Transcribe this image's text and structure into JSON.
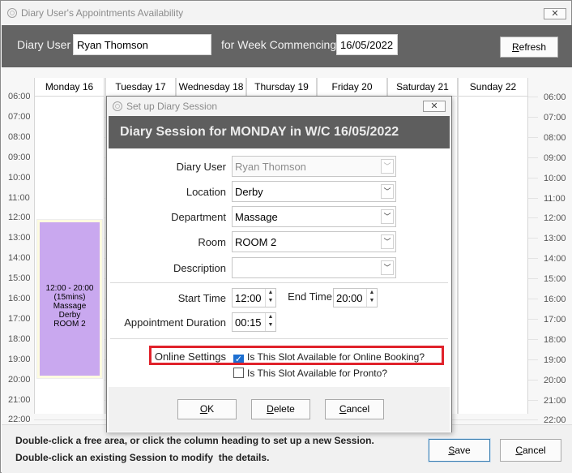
{
  "window": {
    "title": "Diary User's Appointments Availability",
    "close_icon": "close-icon"
  },
  "header": {
    "diary_user_label": "Diary User",
    "diary_user_value": "Ryan Thomson",
    "week_label": "for Week Commencing",
    "week_value": "16/05/2022",
    "refresh_label": "Refresh",
    "refresh_access_key": "R",
    "refresh_rest": "efresh"
  },
  "calendar": {
    "times": [
      "06:00",
      "07:00",
      "08:00",
      "09:00",
      "10:00",
      "11:00",
      "12:00",
      "13:00",
      "14:00",
      "15:00",
      "16:00",
      "17:00",
      "18:00",
      "19:00",
      "20:00",
      "21:00",
      "22:00"
    ],
    "days": [
      "Monday 16",
      "Tuesday 17",
      "Wednesday 18",
      "Thursday 19",
      "Friday 20",
      "Saturday 21",
      "Sunday 22"
    ],
    "session": {
      "time": "12:00 - 20:00",
      "duration": "(15mins)",
      "department": "Massage",
      "location": "Derby",
      "room": "ROOM 2",
      "color": "#c9a8ef"
    }
  },
  "footer": {
    "hint1": "Double-click a free area, or click the column heading to set up a new Session.",
    "hint2": "Double-click an existing Session to modify  the details.",
    "save_label": "Save",
    "save_access_key": "S",
    "save_rest": "ave",
    "cancel_label": "Cancel",
    "cancel_access_key": "C",
    "cancel_rest": "ancel"
  },
  "dialog": {
    "title": "Set up Diary Session",
    "heading": "Diary Session for MONDAY in W/C 16/05/2022",
    "fields": {
      "diary_user_label": "Diary User",
      "diary_user_value": "Ryan Thomson",
      "location_label": "Location",
      "location_value": "Derby",
      "department_label": "Department",
      "department_value": "Massage",
      "room_label": "Room",
      "room_value": "ROOM 2",
      "description_label": "Description",
      "description_value": ""
    },
    "times": {
      "start_label": "Start Time",
      "start_value": "12:00",
      "end_label": "End Time",
      "end_value": "20:00",
      "duration_label": "Appointment Duration",
      "duration_value": "00:15"
    },
    "online": {
      "label": "Online Settings",
      "online_booking_label": "Is This Slot Available for Online Booking?",
      "online_booking_checked": true,
      "pronto_label": "Is This Slot Available for Pronto?",
      "pronto_checked": false,
      "highlight_color": "#e0222b"
    },
    "buttons": {
      "ok_label": "OK",
      "ok_access_key": "O",
      "ok_rest": "K",
      "delete_label": "Delete",
      "delete_access_key": "D",
      "delete_rest": "elete",
      "cancel_label": "Cancel",
      "cancel_access_key": "C",
      "cancel_rest": "ancel"
    }
  }
}
